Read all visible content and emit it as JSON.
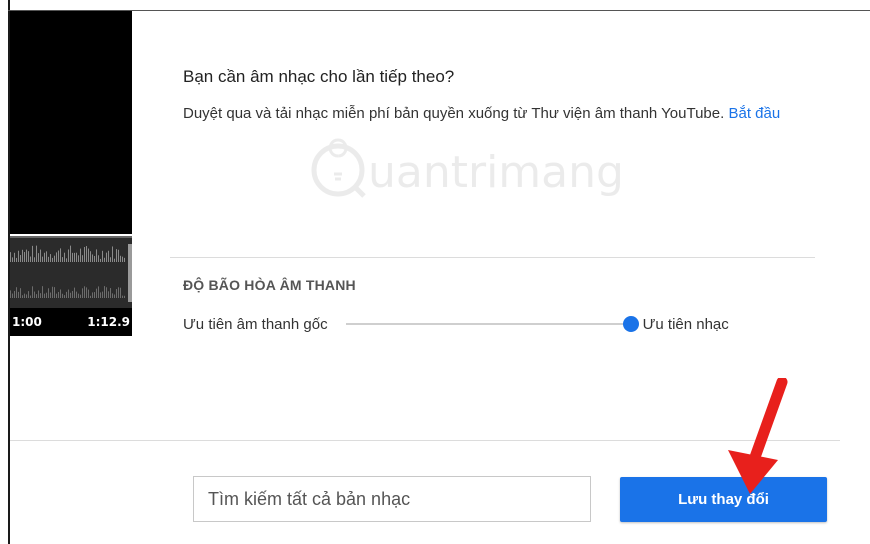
{
  "preview": {
    "time_current": "1:00",
    "time_total": "1:12.9"
  },
  "promo": {
    "heading": "Bạn cần âm nhạc cho lần tiếp theo?",
    "description": "Duyệt qua và tải nhạc miễn phí bản quyền xuống từ Thư viện âm thanh YouTube.",
    "link_label": "Bắt đầu"
  },
  "watermark": {
    "text": "uantrimang"
  },
  "saturation": {
    "title": "ĐỘ BÃO HÒA ÂM THANH",
    "label_left": "Ưu tiên âm thanh gốc",
    "label_right": "Ưu tiên nhạc",
    "value": 1.0
  },
  "footer": {
    "search_placeholder": "Tìm kiếm tất cả bản nhạc",
    "save_label": "Lưu thay đổi"
  },
  "colors": {
    "accent": "#1a73e8",
    "arrow": "#e8201c"
  }
}
